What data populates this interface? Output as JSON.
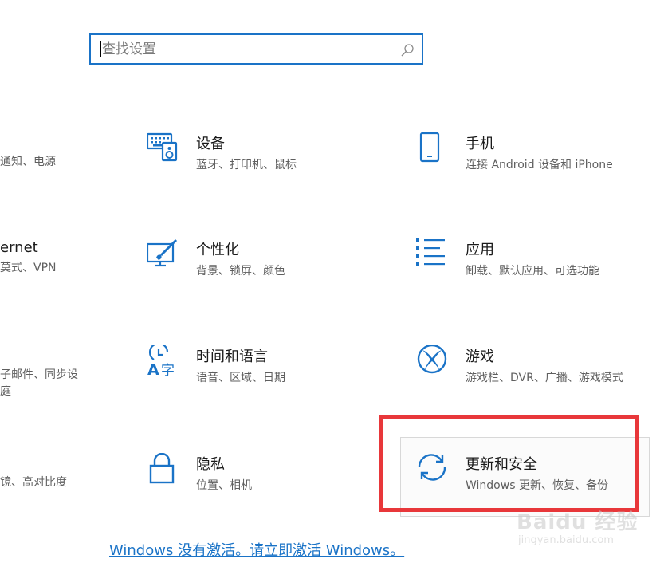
{
  "search": {
    "placeholder": "查找设置"
  },
  "left_column_partial": {
    "row1_desc": "通知、电源",
    "row2_title": "ernet",
    "row2_desc": "莫式、VPN",
    "row3_desc_line1": "子邮件、同步设",
    "row3_desc_line2": "庭",
    "row4_desc": "镜、高对比度"
  },
  "tiles": [
    {
      "title": "设备",
      "desc": "蓝牙、打印机、鼠标",
      "icon": "devices-icon"
    },
    {
      "title": "手机",
      "desc": "连接 Android 设备和 iPhone",
      "icon": "phone-icon"
    },
    {
      "title": "个性化",
      "desc": "背景、锁屏、颜色",
      "icon": "personalization-icon"
    },
    {
      "title": "应用",
      "desc": "卸载、默认应用、可选功能",
      "icon": "apps-icon"
    },
    {
      "title": "时间和语言",
      "desc": "语音、区域、日期",
      "icon": "time-language-icon"
    },
    {
      "title": "游戏",
      "desc": "游戏栏、DVR、广播、游戏模式",
      "icon": "xbox-icon"
    },
    {
      "title": "隐私",
      "desc": "位置、相机",
      "icon": "lock-icon"
    },
    {
      "title": "更新和安全",
      "desc": "Windows 更新、恢复、备份",
      "icon": "update-sync-icon"
    }
  ],
  "activation": {
    "link_text": "Windows 没有激活。请立即激活 Windows。"
  },
  "watermark": {
    "main": "Baidu 经验",
    "sub": "jingyan.baidu.com"
  },
  "colors": {
    "accent": "#1a73c7",
    "highlight": "#e8373a"
  }
}
